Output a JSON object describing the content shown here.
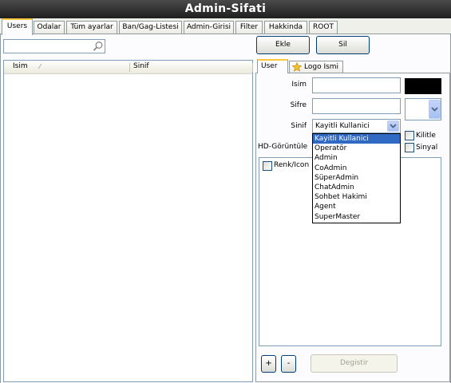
{
  "window": {
    "title": "Admin-Sifati"
  },
  "tabs": [
    {
      "label": "Users"
    },
    {
      "label": "Odalar"
    },
    {
      "label": "Tüm ayarlar"
    },
    {
      "label": "Ban/Gag-Listesi"
    },
    {
      "label": "Admin-Girisi"
    },
    {
      "label": "Filter"
    },
    {
      "label": "Hakkinda"
    },
    {
      "label": "ROOT"
    }
  ],
  "search": {
    "placeholder": "",
    "value": ""
  },
  "user_list": {
    "columns": [
      "Isim",
      "Sinif"
    ]
  },
  "toolbar": {
    "add_label": "Ekle",
    "delete_label": "Sil"
  },
  "detail_tabs": [
    {
      "label": "User"
    },
    {
      "label": "Logo Ismi"
    }
  ],
  "form": {
    "name_label": "Isim",
    "password_label": "Sifre",
    "class_label": "Sinif",
    "class_value": "Kayitli Kullanici",
    "hd_label": "HD-Görüntüle",
    "lock_label": "Kilitle",
    "signal_label": "Sinyal",
    "color_label": "Renk/Icon",
    "name_color": "#000000"
  },
  "class_options": [
    "Kayitli Kullanici",
    "Operatör",
    "Admin",
    "CoAdmin",
    "SüperAdmin",
    "ChatAdmin",
    "Sohbet Hakimi",
    "Agent",
    "SuperMaster"
  ],
  "bottom": {
    "plus_label": "+",
    "minus_label": "-",
    "change_label": "Degistir"
  }
}
